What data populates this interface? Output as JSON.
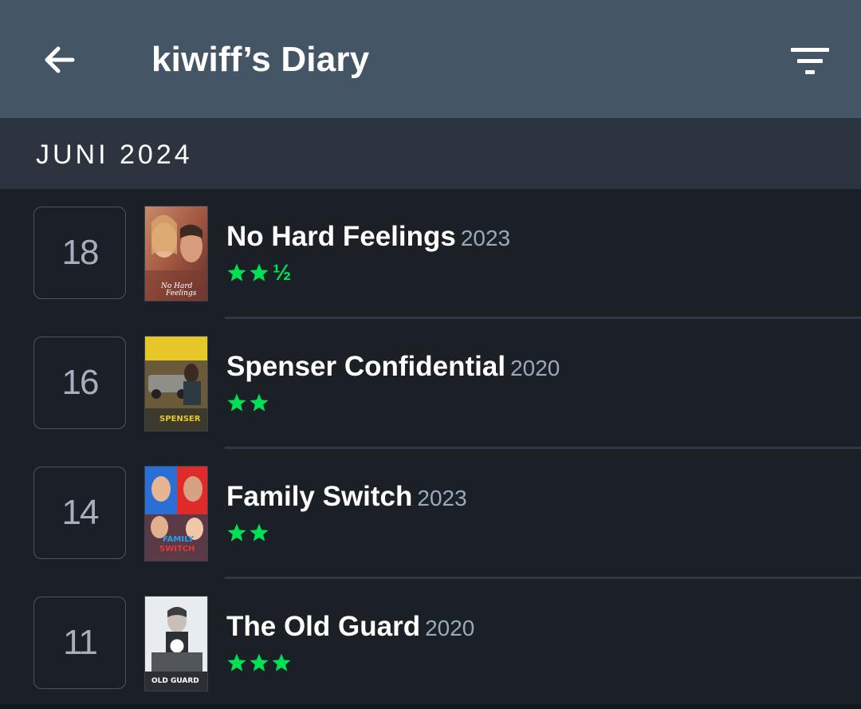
{
  "header": {
    "title": "kiwiff’s Diary",
    "back_icon": "arrow-left-icon",
    "filter_icon": "filter-icon"
  },
  "month": "JUNI 2024",
  "colors": {
    "appbar": "#445566",
    "star": "#00e054",
    "background": "#14181c"
  },
  "entries": [
    {
      "day": "18",
      "title": "No Hard Feelings",
      "year": "2023",
      "rating": 2.5,
      "poster_text": "No Hard Feelings"
    },
    {
      "day": "16",
      "title": "Spenser Confidential",
      "year": "2020",
      "rating": 2,
      "poster_text": "SPENSER"
    },
    {
      "day": "14",
      "title": "Family Switch",
      "year": "2023",
      "rating": 2,
      "poster_text": "FAMILY SWITCH"
    },
    {
      "day": "11",
      "title": "The Old Guard",
      "year": "2020",
      "rating": 3,
      "poster_text": "OLD GUARD"
    }
  ]
}
